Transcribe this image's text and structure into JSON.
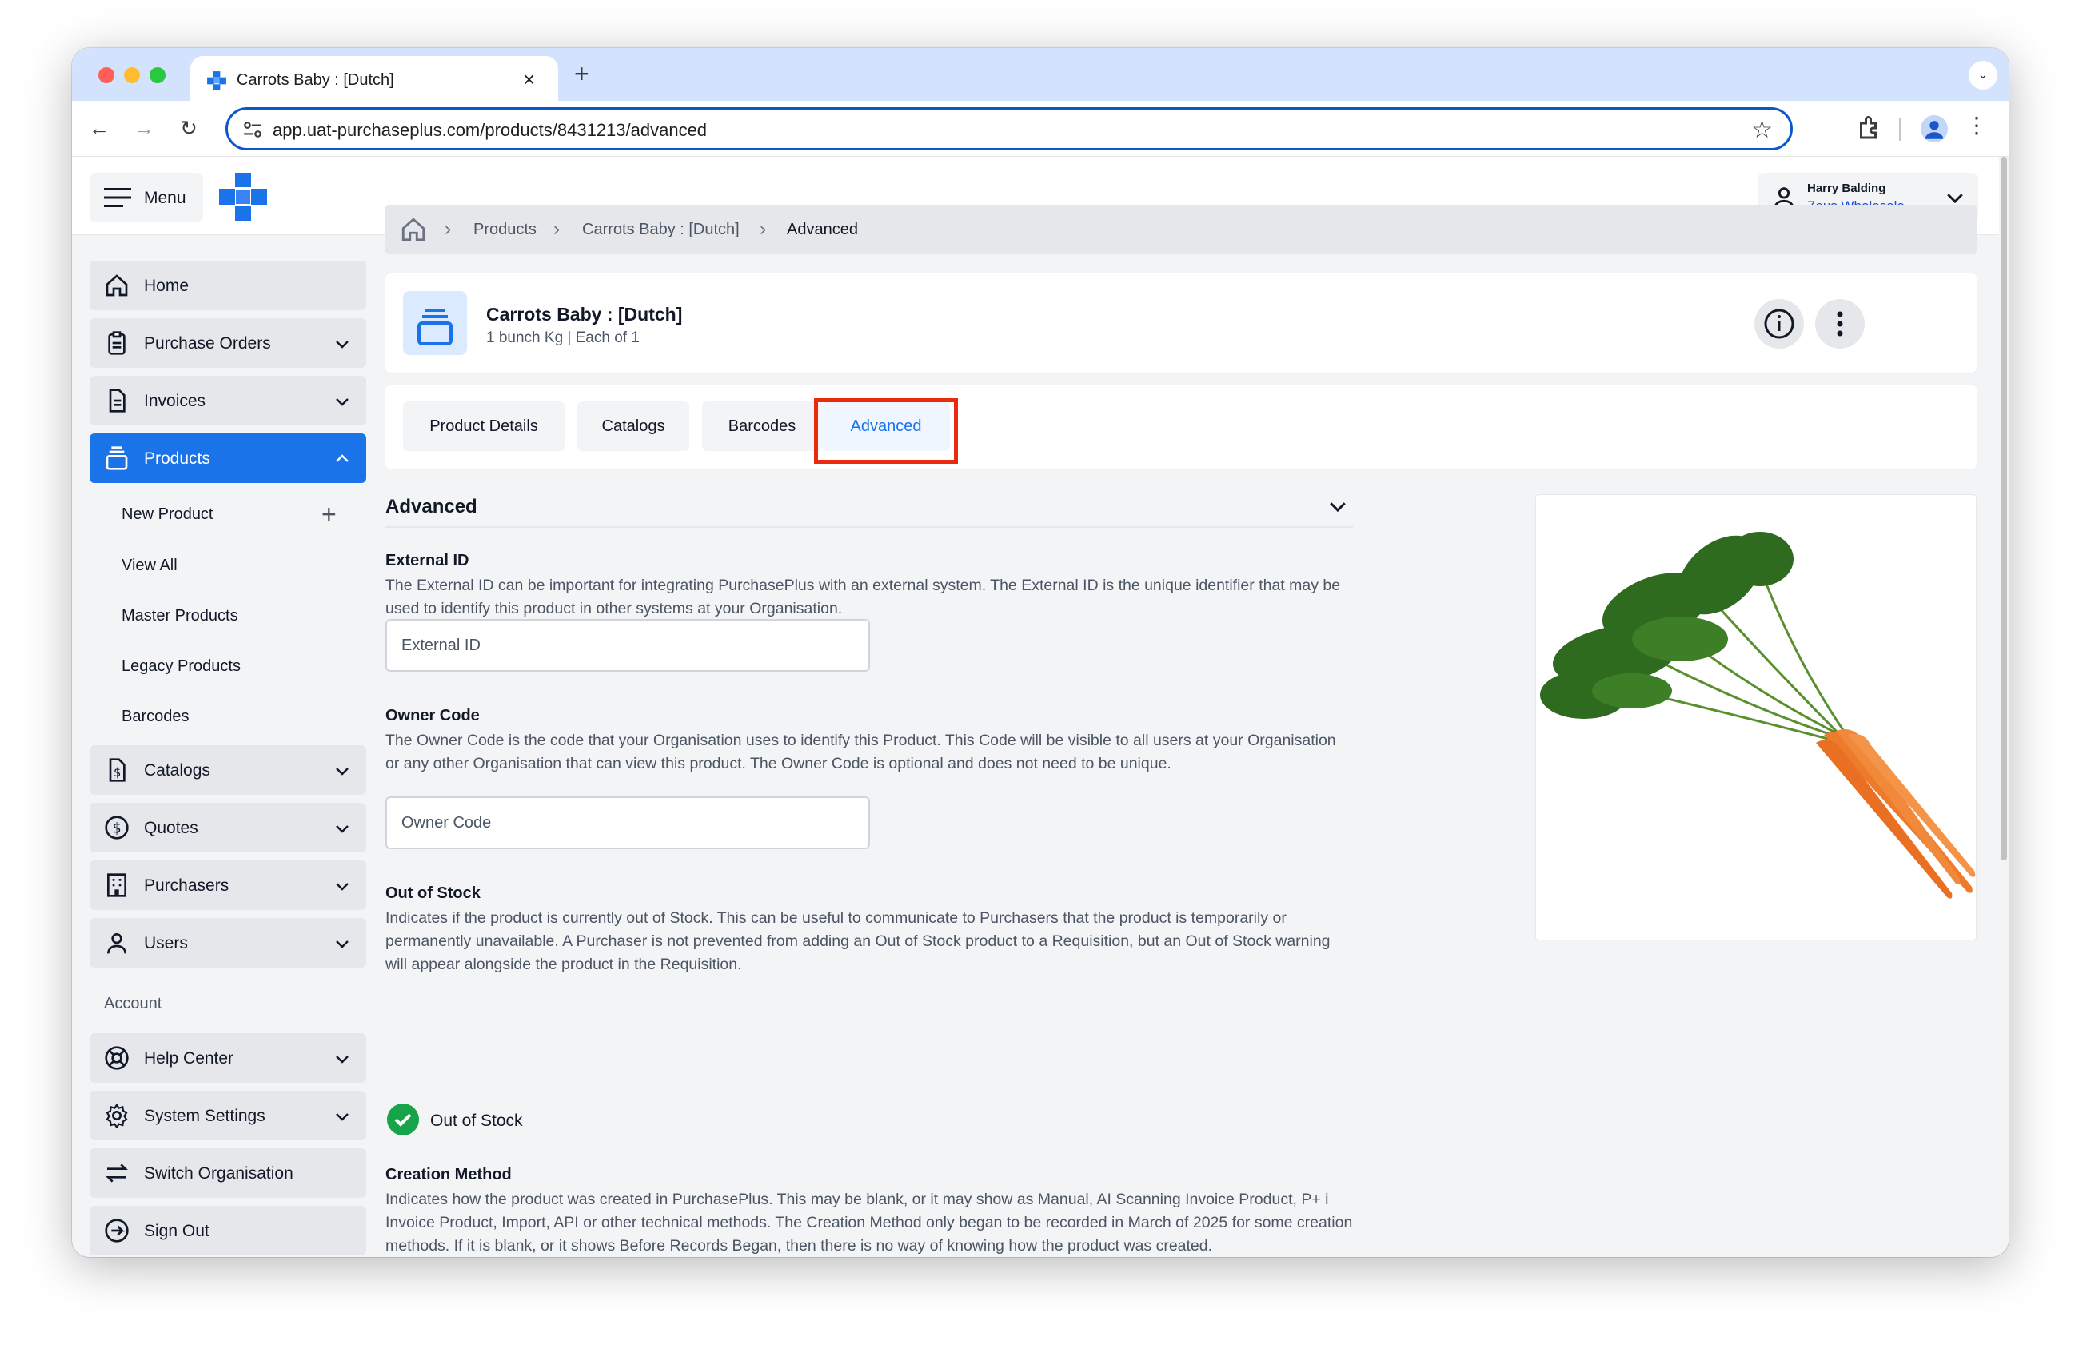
{
  "browser": {
    "tab_title": "Carrots Baby : [Dutch]",
    "url": "app.uat-purchaseplus.com/products/8431213/advanced"
  },
  "header": {
    "menu_label": "Menu",
    "user_name": "Harry Balding",
    "user_org": "Zeus Wholesale"
  },
  "sidebar": {
    "items": [
      {
        "label": "Home",
        "icon": "home-icon"
      },
      {
        "label": "Purchase Orders",
        "icon": "clipboard-icon"
      },
      {
        "label": "Invoices",
        "icon": "invoice-icon"
      },
      {
        "label": "Products",
        "icon": "products-icon"
      },
      {
        "label": "Catalogs",
        "icon": "catalog-icon"
      },
      {
        "label": "Quotes",
        "icon": "dollar-circle-icon"
      },
      {
        "label": "Purchasers",
        "icon": "building-icon"
      },
      {
        "label": "Users",
        "icon": "user-icon"
      },
      {
        "label": "Help Center",
        "icon": "lifebuoy-icon"
      },
      {
        "label": "System Settings",
        "icon": "gear-icon"
      },
      {
        "label": "Switch Organisation",
        "icon": "switch-icon"
      },
      {
        "label": "Sign Out",
        "icon": "sign-out-icon"
      }
    ],
    "products_sub": [
      "New Product",
      "View All",
      "Master Products",
      "Legacy Products",
      "Barcodes"
    ],
    "account_heading": "Account"
  },
  "breadcrumb": {
    "items": [
      "Products",
      "Carrots Baby : [Dutch]",
      "Advanced"
    ]
  },
  "product": {
    "title": "Carrots Baby : [Dutch]",
    "subtitle": "1 bunch Kg | Each of 1"
  },
  "tabs": [
    "Product Details",
    "Catalogs",
    "Barcodes",
    "Advanced"
  ],
  "advanced": {
    "section_title": "Advanced",
    "external_id": {
      "label": "External ID",
      "help": "The External ID can be important for integrating PurchasePlus with an external system. The External ID is the unique identifier that may be used to identify this product in other systems at your Organisation.",
      "placeholder": "External ID"
    },
    "owner_code": {
      "label": "Owner Code",
      "help": "The Owner Code is the code that your Organisation uses to identify this Product. This Code will be visible to all users at your Organisation or any other Organisation that can view this product. The Owner Code is optional and does not need to be unique.",
      "placeholder": "Owner Code"
    },
    "out_of_stock": {
      "label": "Out of Stock",
      "help": "Indicates if the product is currently out of Stock. This can be useful to communicate to Purchasers that the product is temporarily or permanently unavailable. A Purchaser is not prevented from adding an Out of Stock product to a Requisition, but an Out of Stock warning will appear alongside the product in the Requisition.",
      "checkbox_label": "Out of Stock",
      "checked": true
    },
    "creation_method": {
      "label": "Creation Method",
      "help": "Indicates how the product was created in PurchasePlus. This may be blank, or it may show as Manual, AI Scanning Invoice Product, P+ i Invoice Product, Import, API or other technical methods. The Creation Method only began to be recorded in March of 2025 for some creation methods. If it is blank, or it shows Before Records Began, then there is no way of knowing how the product was created."
    }
  },
  "colors": {
    "accent": "#1a73e8",
    "highlight": "#ea2a0c",
    "checked": "#16a34a"
  }
}
